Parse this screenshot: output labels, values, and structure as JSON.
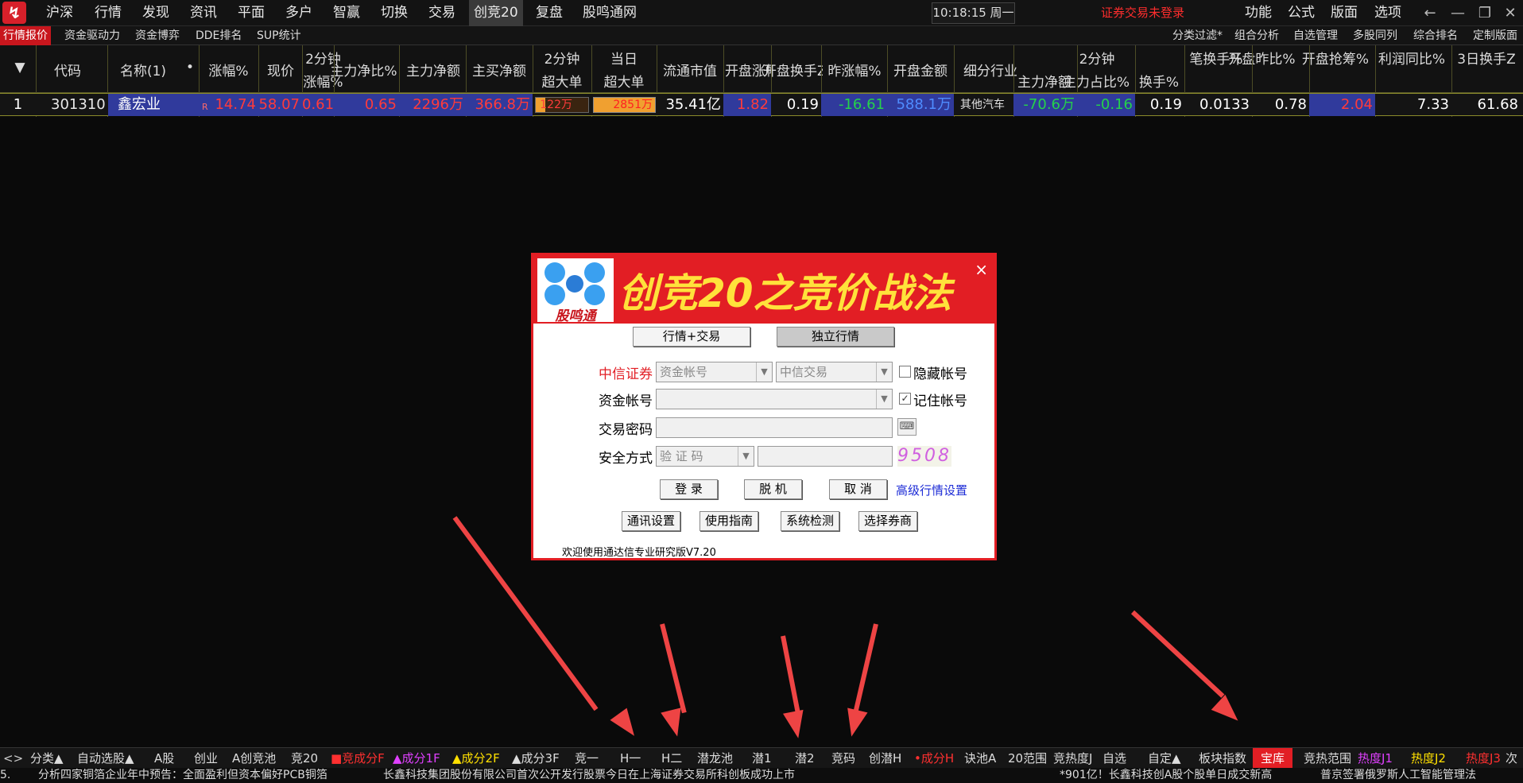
{
  "menubar": {
    "items": [
      "沪深",
      "行情",
      "发现",
      "资讯",
      "平面",
      "多户",
      "智赢",
      "切换",
      "交易",
      "创竞20",
      "复盘",
      "股鸣通网"
    ],
    "active": "创竞20",
    "clock": "10:18:15 周一",
    "trade_status": "证券交易未登录",
    "right_items": [
      "功能",
      "公式",
      "版面",
      "选项"
    ]
  },
  "subtabs": {
    "left": [
      "行情报价",
      "资金驱动力",
      "资金博弈",
      "DDE排名",
      "SUP统计"
    ],
    "right": [
      "分类过滤*",
      "组合分析",
      "自选管理",
      "多股同列",
      "综合排名",
      "定制版面"
    ]
  },
  "table": {
    "headers": {
      "sort": "▼",
      "code": "代码",
      "name": "名称(1)",
      "dot": "•",
      "chg": "涨幅%",
      "price": "现价",
      "chg2_top": "2分钟",
      "chg2_bot": "涨幅%",
      "main_ratio": "主力净比%",
      "main_net": "主力净额",
      "buy_net": "主买净额",
      "big2_top": "2分钟",
      "big2_bot": "超大单",
      "bigday_top": "当日",
      "bigday_bot": "超大单",
      "float_cap": "流通市值",
      "open_chg": "开盘涨幅",
      "open_turn": "开盘换手Z",
      "prev_chg": "昨涨幅%",
      "open_amt": "开盘金额",
      "industry": "细分行业",
      "g2_top": "2分钟",
      "g2_net": "主力净额",
      "g2_ratio": "主力占比%",
      "g2_turn": "换手%",
      "per_turn": "笔换手%",
      "open_prev": "开盘昨比%",
      "open_grab": "开盘抢筹%",
      "profit": "利润同比%",
      "turn3": "3日换手Z"
    },
    "row": {
      "idx": "1",
      "code": "301310",
      "name": "鑫宏业",
      "flag": "R",
      "chg": "14.74",
      "price": "58.07",
      "chg2": "0.61",
      "main_ratio": "0.65",
      "main_net": "2296万",
      "buy_net": "366.8万",
      "big2": "122万",
      "bigday": "2851万",
      "float_cap": "35.41亿",
      "open_chg": "1.82",
      "open_turn": "0.19",
      "prev_chg": "-16.61",
      "open_amt": "588.1万",
      "industry": "其他汽车",
      "g2_net": "-70.6万",
      "g2_ratio": "-0.16",
      "g2_turn": "0.19",
      "per_turn": "0.0133",
      "open_prev": "0.78",
      "open_grab": "2.04",
      "profit": "7.33",
      "turn3": "61.68"
    }
  },
  "dialog": {
    "logo_text": "股鸣通",
    "title": "创竞20之竞价战法",
    "close": "×",
    "mode_btn1": "行情+交易",
    "mode_btn2": "独立行情",
    "broker_label": "中信证券",
    "acct_type": "资金帐号",
    "acct_server": "中信交易",
    "hide_acct": "隐藏帐号",
    "acct_label": "资金帐号",
    "remember": "记住帐号",
    "pwd_label": "交易密码",
    "sec_label": "安全方式",
    "sec_value": "验 证 码",
    "captcha": "9508",
    "login": "登 录",
    "offline": "脱 机",
    "cancel": "取 消",
    "adv_link": "高级行情设置",
    "comm": "通讯设置",
    "guide": "使用指南",
    "check": "系统检测",
    "broker_sel": "选择券商",
    "welcome": "欢迎使用通达信专业研究版V7.20"
  },
  "bottom_tabs": [
    {
      "label": "<>",
      "color": "#cccccc"
    },
    {
      "label": "分类▲",
      "color": "#dddddd"
    },
    {
      "label": "自动选股▲",
      "color": "#dddddd"
    },
    {
      "label": "A股",
      "color": "#dddddd"
    },
    {
      "label": "创业",
      "color": "#dddddd"
    },
    {
      "label": "A创竞池",
      "color": "#dddddd"
    },
    {
      "label": "竞20",
      "color": "#dddddd"
    },
    {
      "label": "■竞成分F",
      "color": "#ff3030"
    },
    {
      "label": "▲成分1F",
      "color": "#e040ff"
    },
    {
      "label": "▲成分2F",
      "color": "#ffe000"
    },
    {
      "label": "▲成分3F",
      "color": "#dddddd"
    },
    {
      "label": "竞一",
      "color": "#dddddd"
    },
    {
      "label": "H一",
      "color": "#dddddd"
    },
    {
      "label": "H二",
      "color": "#dddddd"
    },
    {
      "label": "潜龙池",
      "color": "#dddddd"
    },
    {
      "label": "潜1",
      "color": "#dddddd"
    },
    {
      "label": "潜2",
      "color": "#dddddd"
    },
    {
      "label": "竞码",
      "color": "#dddddd"
    },
    {
      "label": "创潜H",
      "color": "#dddddd"
    },
    {
      "label": "•成分H",
      "color": "#ff3030"
    },
    {
      "label": "诀池A",
      "color": "#dddddd"
    },
    {
      "label": "20范围",
      "color": "#dddddd"
    },
    {
      "label": "竞热度J",
      "color": "#dddddd"
    },
    {
      "label": "自选",
      "color": "#dddddd"
    },
    {
      "label": "自定▲",
      "color": "#dddddd"
    },
    {
      "label": "板块指数",
      "color": "#dddddd"
    },
    {
      "label": "宝库",
      "color": "#ffffff"
    },
    {
      "label": "竞热范围",
      "color": "#dddddd"
    },
    {
      "label": "热度J1",
      "color": "#e040ff"
    },
    {
      "label": "热度J2",
      "color": "#ffe000"
    },
    {
      "label": "热度J3",
      "color": "#ff3030"
    },
    {
      "label": "次",
      "color": "#dddddd"
    }
  ],
  "ticker": [
    "分析四家铜箔企业年中预告：全面盈利但资本偏好PCB铜箔",
    "长鑫科技集团股份有限公司首次公开发行股票今日在上海证券交易所科创板成功上市",
    "*901亿！长鑫科技创A股个股单日成交新高",
    "普京签署俄罗斯人工智能管理法"
  ],
  "colors": {
    "up": "#ff3b3b",
    "down": "#25d24a",
    "blue": "#4f8cff",
    "accent": "#e21e24",
    "arrow": "#ee4444"
  }
}
